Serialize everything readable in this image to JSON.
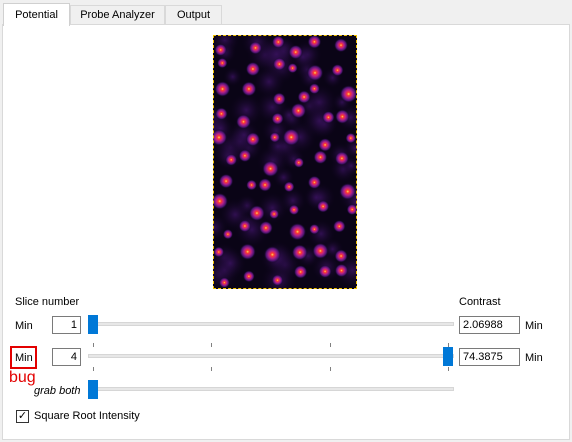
{
  "tabs": [
    {
      "label": "Potential",
      "active": true
    },
    {
      "label": "Probe Analyzer",
      "active": false
    },
    {
      "label": "Output",
      "active": false
    }
  ],
  "slice": {
    "heading": "Slice number",
    "min_label": "Min",
    "min_value": "1",
    "max_label": "Min",
    "max_value": "4",
    "grab_both": "grab both",
    "min_slider_fraction": 0.0,
    "max_slider_fraction": 1.0,
    "grab_slider_fraction": 0.0
  },
  "contrast": {
    "heading": "Contrast",
    "min_value": "2.06988",
    "min_label": "Min",
    "max_value": "74.3875",
    "max_label": "Min"
  },
  "annotation": {
    "text": "bug",
    "color": "#e30000"
  },
  "checkbox": {
    "label": "Square Root Intensity",
    "checked": true,
    "check_glyph": "✓"
  },
  "colors": {
    "accent": "#0078d7",
    "image_background": "#0a0416",
    "image_border": "#f2c200"
  }
}
